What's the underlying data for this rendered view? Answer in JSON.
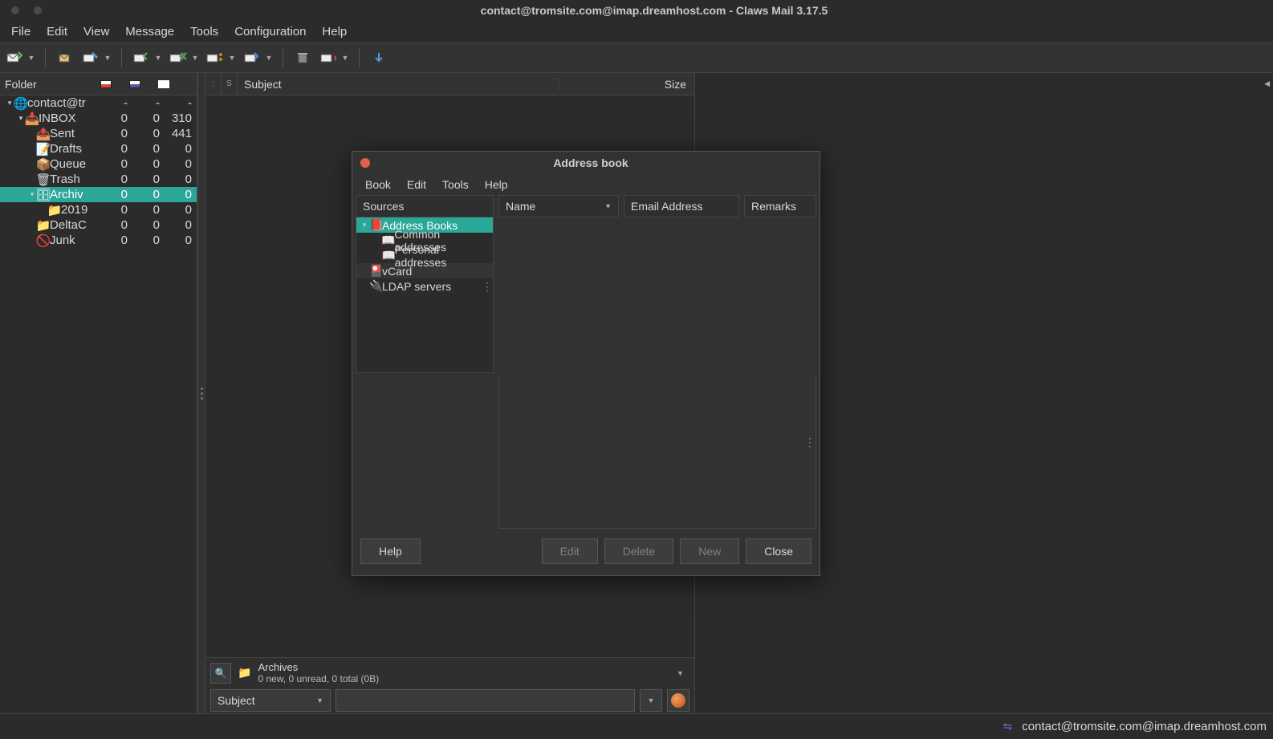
{
  "window": {
    "title": "contact@tromsite.com@imap.dreamhost.com - Claws Mail 3.17.5"
  },
  "menubar": [
    "File",
    "Edit",
    "View",
    "Message",
    "Tools",
    "Configuration",
    "Help"
  ],
  "folder_header": {
    "label": "Folder"
  },
  "folders": [
    {
      "name": "contact@tr",
      "depth": 0,
      "expand": true,
      "c1": "-",
      "c2": "-",
      "c3": "-",
      "acct": true,
      "sel": false,
      "ficon": "account"
    },
    {
      "name": "INBOX",
      "depth": 1,
      "expand": true,
      "c1": "0",
      "c2": "0",
      "c3": "310",
      "sel": false,
      "ficon": "inbox"
    },
    {
      "name": "Sent",
      "depth": 2,
      "expand": false,
      "c1": "0",
      "c2": "0",
      "c3": "441",
      "sel": false,
      "ficon": "sent"
    },
    {
      "name": "Drafts",
      "depth": 2,
      "expand": false,
      "c1": "0",
      "c2": "0",
      "c3": "0",
      "sel": false,
      "ficon": "drafts"
    },
    {
      "name": "Queue",
      "depth": 2,
      "expand": false,
      "c1": "0",
      "c2": "0",
      "c3": "0",
      "sel": false,
      "ficon": "queue"
    },
    {
      "name": "Trash",
      "depth": 2,
      "expand": false,
      "c1": "0",
      "c2": "0",
      "c3": "0",
      "sel": false,
      "ficon": "trash"
    },
    {
      "name": "Archiv",
      "depth": 2,
      "expand": true,
      "c1": "0",
      "c2": "0",
      "c3": "0",
      "sel": true,
      "ficon": "archive"
    },
    {
      "name": "2019",
      "depth": 3,
      "expand": false,
      "c1": "0",
      "c2": "0",
      "c3": "0",
      "sel": false,
      "ficon": "folder"
    },
    {
      "name": "DeltaC",
      "depth": 2,
      "expand": false,
      "c1": "0",
      "c2": "0",
      "c3": "0",
      "sel": false,
      "ficon": "folder"
    },
    {
      "name": "Junk",
      "depth": 2,
      "expand": false,
      "c1": "0",
      "c2": "0",
      "c3": "0",
      "sel": false,
      "ficon": "junk"
    }
  ],
  "msg_header": {
    "subject": "Subject",
    "size": "Size"
  },
  "folder_info": {
    "name": "Archives",
    "summary": "0 new, 0 unread, 0 total (0B)"
  },
  "search": {
    "field": "Subject"
  },
  "statusbar": {
    "account": "contact@tromsite.com@imap.dreamhost.com"
  },
  "dialog": {
    "title": "Address book",
    "menubar": [
      "Book",
      "Edit",
      "Tools",
      "Help"
    ],
    "cols": {
      "sources": "Sources",
      "name": "Name",
      "email": "Email Address",
      "remarks": "Remarks"
    },
    "tree": [
      {
        "name": "Address Books",
        "depth": 0,
        "expand": true,
        "sel": true,
        "alt": false,
        "ic": "book"
      },
      {
        "name": "Common addresses",
        "depth": 1,
        "expand": false,
        "sel": false,
        "alt": false,
        "ic": "sub"
      },
      {
        "name": "Personal addresses",
        "depth": 1,
        "expand": false,
        "sel": false,
        "alt": false,
        "ic": "sub"
      },
      {
        "name": "vCard",
        "depth": 0,
        "expand": false,
        "sel": false,
        "alt": true,
        "ic": "vcard"
      },
      {
        "name": "LDAP servers",
        "depth": 0,
        "expand": false,
        "sel": false,
        "alt": false,
        "ic": "ldap"
      }
    ],
    "buttons": {
      "help": "Help",
      "edit": "Edit",
      "delete": "Delete",
      "new": "New",
      "close": "Close"
    }
  }
}
